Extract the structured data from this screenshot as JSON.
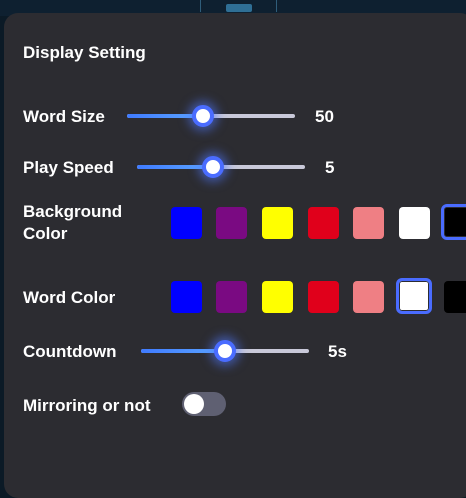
{
  "panel": {
    "title": "Display Setting"
  },
  "word_size": {
    "label": "Word Size",
    "value": "50",
    "level": 0.45
  },
  "play_speed": {
    "label": "Play Speed",
    "value": "5",
    "level": 0.45
  },
  "background_color": {
    "label": "Background Color",
    "swatches": [
      {
        "name": "blue",
        "color": "#0000ff",
        "selected": false
      },
      {
        "name": "purple",
        "color": "#7a0a82",
        "selected": false
      },
      {
        "name": "yellow",
        "color": "#ffff00",
        "selected": false
      },
      {
        "name": "red",
        "color": "#e0001b",
        "selected": false
      },
      {
        "name": "pink",
        "color": "#ef7f84",
        "selected": false
      },
      {
        "name": "white",
        "color": "#ffffff",
        "selected": false
      },
      {
        "name": "black",
        "color": "#000000",
        "selected": true
      }
    ]
  },
  "word_color": {
    "label": "Word Color",
    "swatches": [
      {
        "name": "blue",
        "color": "#0000ff",
        "selected": false
      },
      {
        "name": "purple",
        "color": "#7a0a82",
        "selected": false
      },
      {
        "name": "yellow",
        "color": "#ffff00",
        "selected": false
      },
      {
        "name": "red",
        "color": "#e0001b",
        "selected": false
      },
      {
        "name": "pink",
        "color": "#ef7f84",
        "selected": false
      },
      {
        "name": "white",
        "color": "#ffffff",
        "selected": true
      },
      {
        "name": "black",
        "color": "#000000",
        "selected": false
      }
    ]
  },
  "countdown": {
    "label": "Countdown",
    "value": "5s",
    "level": 0.5
  },
  "mirroring": {
    "label": "Mirroring or not",
    "on": false
  },
  "colors": {
    "panel_bg": "#2c2c31",
    "accent": "#4a6cff",
    "toggle_off": "#5f6072"
  }
}
